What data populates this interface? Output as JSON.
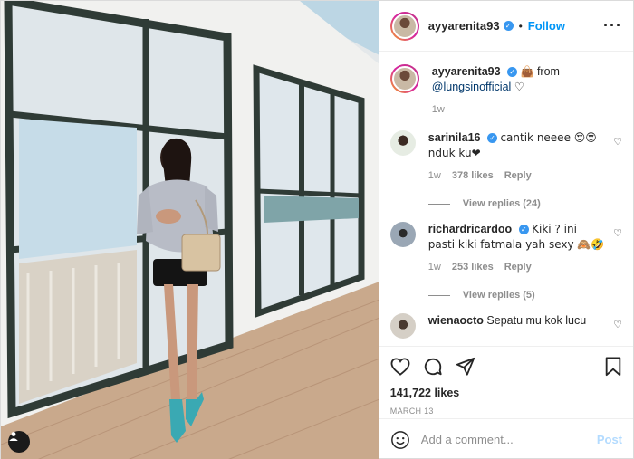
{
  "post": {
    "author": "ayyarenita93",
    "follow_label": "Follow",
    "dot": "•",
    "caption": {
      "author": "ayyarenita93",
      "emoji": "👜",
      "text": " from",
      "mention": "@lungsinofficial",
      "heart": "♡",
      "time": "1w"
    }
  },
  "comments": [
    {
      "user": "sarinila16",
      "verified": true,
      "text": "cantik neeee 😍😍 nduk ku❤",
      "time": "1w",
      "likes": "378 likes",
      "reply": "Reply",
      "replies": "View replies (24)"
    },
    {
      "user": "richardricardoo",
      "verified": true,
      "text": "Kiki ? ini pasti kiki fatmala yah sexy 🙈🤣",
      "time": "1w",
      "likes": "253 likes",
      "reply": "Reply",
      "replies": "View replies (5)"
    },
    {
      "user": "wienaocto",
      "verified": false,
      "text": "Sepatu mu kok lucu",
      "time": "",
      "likes": "",
      "reply": "",
      "replies": ""
    }
  ],
  "engagement": {
    "likes": "141,722 likes",
    "date": "MARCH 13"
  },
  "add_comment": {
    "placeholder": "Add a comment...",
    "post_label": "Post"
  },
  "icons": {
    "tag": "user-tag-icon",
    "more": "more-options-icon",
    "like": "heart-icon",
    "comment": "comment-icon",
    "share": "share-icon",
    "save": "bookmark-icon",
    "emoji": "smiley-icon"
  },
  "colors": {
    "link": "#00376b",
    "follow": "#0095f6",
    "verified": "#3897f0",
    "muted": "#8e8e8e"
  }
}
